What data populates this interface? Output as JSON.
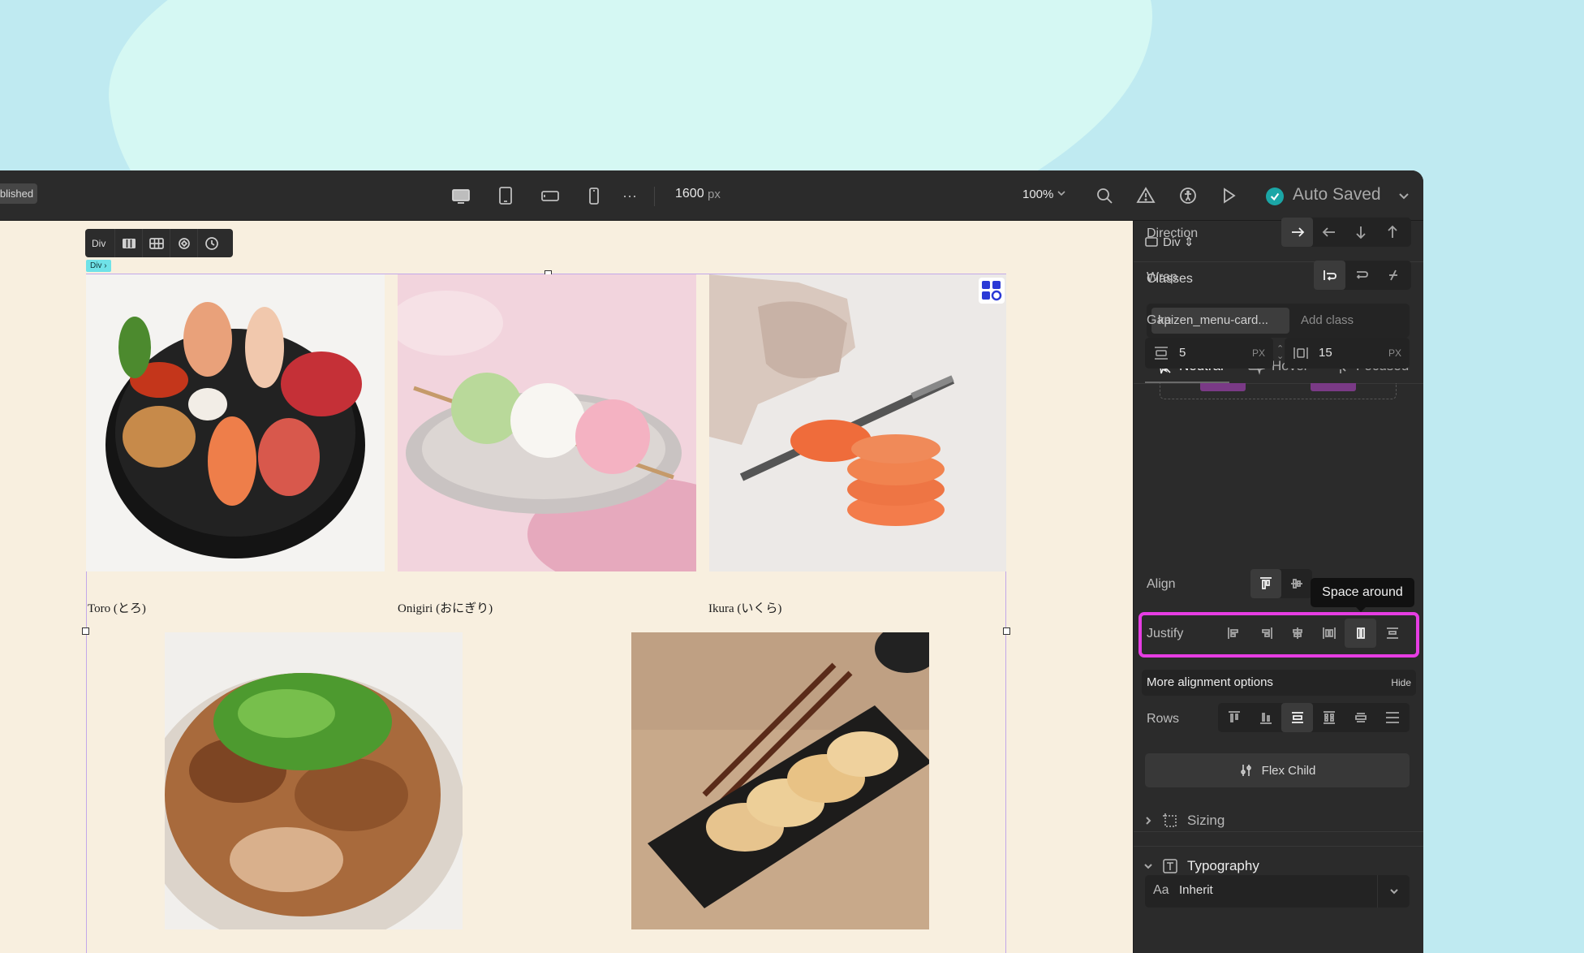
{
  "topbar": {
    "published_label": "Published",
    "canvas_width": "1600",
    "canvas_width_unit": "px",
    "zoom": "100%",
    "save_status": "Auto Saved",
    "more_label": "···"
  },
  "canvas": {
    "toolbar_label": "Div",
    "breadcrumb_tag": "Div ›",
    "captions": [
      "Toro (とろ)",
      "Onigiri (おにぎり)",
      "Ikura (いくら)"
    ]
  },
  "panel": {
    "element_type": "Div ⇕",
    "dots": "···",
    "classes_title": "Classes",
    "class_chip": "kaizen_menu-card...",
    "add_class_placeholder": "Add class",
    "states": [
      "Neutral",
      "Hover",
      "Focused"
    ],
    "direction_label": "Direction",
    "wrap_label": "Wrap",
    "gap_label": "Gap",
    "gap_row_value": "5",
    "gap_col_value": "15",
    "gap_unit": "PX",
    "align_label": "Align",
    "tooltip": "Space around",
    "justify_label": "Justify",
    "more_alignment": "More alignment options",
    "hide_label": "Hide",
    "rows_label": "Rows",
    "flex_child_label": "Flex Child",
    "sizing_label": "Sizing",
    "typography_label": "Typography",
    "font_prefix": "Aa",
    "font_value": "Inherit"
  },
  "colors": {
    "highlight": "#e63de3",
    "saved_check": "#1ba6a6",
    "canvas_bg": "#f8efdf"
  }
}
